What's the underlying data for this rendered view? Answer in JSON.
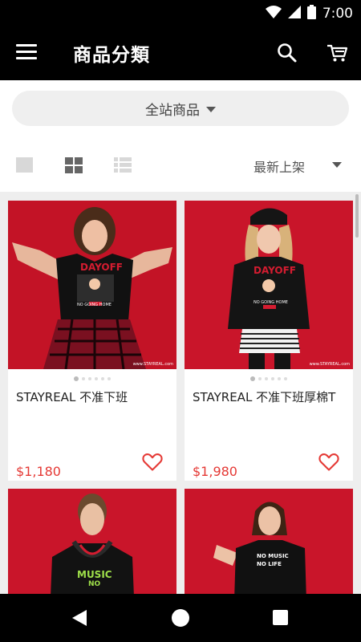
{
  "status": {
    "time": "7:00"
  },
  "app_bar": {
    "title": "商品分類"
  },
  "filter": {
    "category": "全站商品",
    "sort": "最新上架"
  },
  "products": [
    {
      "name": "STAYREAL 不准下班",
      "price": "$1,180",
      "shirt_text": "DAYOFF",
      "shirt_sub": "NO GOING HOME",
      "watermark": "www.STAYREAL.com"
    },
    {
      "name": "STAYREAL 不准下班厚棉T",
      "price": "$1,980",
      "shirt_text": "DAYOFF",
      "shirt_sub": "NO GOING HOME",
      "watermark": "www.STAYREAL.com"
    },
    {
      "name": "",
      "price": "",
      "shirt_text": "MUSIC",
      "shirt_sub": "NO"
    },
    {
      "name": "",
      "price": "",
      "shirt_text": "NO MUSIC",
      "shirt_sub": "NO LIFE"
    }
  ],
  "colors": {
    "accent": "#e53935",
    "photo_bg": "#c9152a",
    "bar": "#000000"
  }
}
